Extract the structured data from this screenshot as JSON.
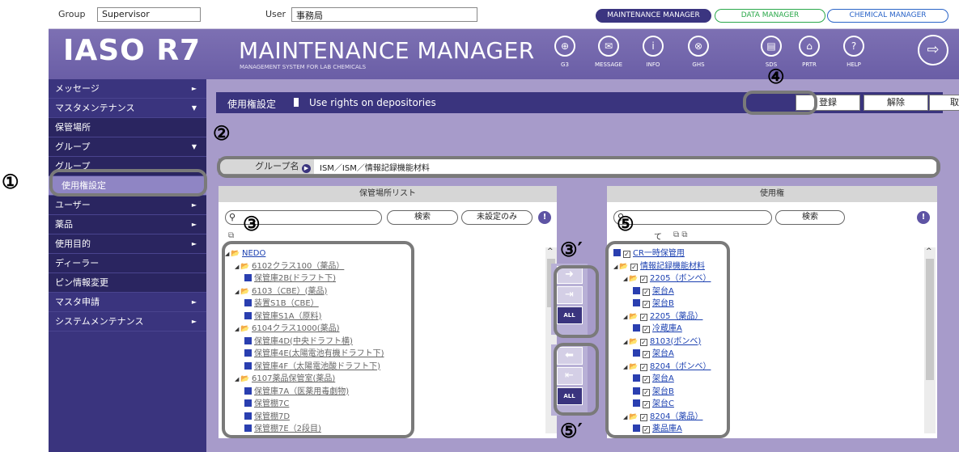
{
  "top": {
    "group_label": "Group",
    "group_value": "Supervisor",
    "user_label": "User",
    "user_value": "事務局",
    "tabs": [
      "MAINTENANCE MANAGER",
      "DATA MANAGER",
      "CHEMICAL MANAGER"
    ]
  },
  "header": {
    "logo": "IASO R7",
    "title": "MAINTENANCE MANAGER",
    "subtitle": "MANAGEMENT SYSTEM FOR LAB CHEMICALS",
    "icons": [
      {
        "name": "g3-icon",
        "label": "G3",
        "glyph": "⊕"
      },
      {
        "name": "message-icon",
        "label": "MESSAGE",
        "glyph": "✉"
      },
      {
        "name": "info-icon",
        "label": "INFO",
        "glyph": "i"
      },
      {
        "name": "ghs-icon",
        "label": "GHS",
        "glyph": "⊗"
      },
      {
        "name": "sds-icon",
        "label": "SDS",
        "glyph": "▤"
      },
      {
        "name": "prtr-icon",
        "label": "PRTR",
        "glyph": "⌂"
      },
      {
        "name": "help-icon",
        "label": "HELP",
        "glyph": "?"
      }
    ]
  },
  "sidebar": {
    "items": [
      {
        "label": "メッセージ",
        "arrow": "►",
        "kind": "top"
      },
      {
        "label": "マスタメンテナンス",
        "arrow": "▼",
        "kind": "top"
      },
      {
        "label": "保管場所",
        "arrow": "",
        "kind": "sub"
      },
      {
        "label": "グループ",
        "arrow": "▼",
        "kind": "sub"
      },
      {
        "label": "グループ",
        "arrow": "",
        "kind": "sub"
      },
      {
        "label": "使用権設定",
        "arrow": "",
        "kind": "active"
      },
      {
        "label": "ユーザー",
        "arrow": "►",
        "kind": "sub"
      },
      {
        "label": "薬品",
        "arrow": "►",
        "kind": "sub"
      },
      {
        "label": "使用目的",
        "arrow": "►",
        "kind": "sub"
      },
      {
        "label": "ディーラー",
        "arrow": "",
        "kind": "sub"
      },
      {
        "label": "ピン情報変更",
        "arrow": "",
        "kind": "sub"
      },
      {
        "label": "マスタ申請",
        "arrow": "►",
        "kind": "top"
      },
      {
        "label": "システムメンテナンス",
        "arrow": "►",
        "kind": "top"
      }
    ]
  },
  "main": {
    "title_jp": "使用権設定",
    "title_en": "Use rights on depositories",
    "buttons": {
      "register": "登録",
      "release": "解除",
      "cancel": "取消"
    },
    "group_name_label": "グループ名",
    "group_name_value": "ISM／ISM／情報記録機能材料"
  },
  "left_panel": {
    "header": "保管場所リスト",
    "search_btn": "検索",
    "unset_btn": "未設定のみ",
    "tree": [
      {
        "indent": 0,
        "type": "root",
        "label": "NEDO"
      },
      {
        "indent": 1,
        "type": "folder",
        "label": "6102クラス100（薬品）"
      },
      {
        "indent": 2,
        "type": "depo",
        "label": "保管庫2B(ドラフト下)"
      },
      {
        "indent": 1,
        "type": "folder",
        "label": "6103（CBE）(薬品)"
      },
      {
        "indent": 2,
        "type": "depo",
        "label": "装置S1B（CBE）"
      },
      {
        "indent": 2,
        "type": "depo",
        "label": "保管庫S1A（原料)"
      },
      {
        "indent": 1,
        "type": "folder",
        "label": "6104クラス1000(薬品)"
      },
      {
        "indent": 2,
        "type": "depo",
        "label": "保管庫4D(中央ドラフト横)"
      },
      {
        "indent": 2,
        "type": "depo",
        "label": "保管庫4E(太陽電池有機ドラフト下)"
      },
      {
        "indent": 2,
        "type": "depo",
        "label": "保管庫4F（太陽電池酸ドラフト下)"
      },
      {
        "indent": 1,
        "type": "folder",
        "label": "6107薬品保管室(薬品)"
      },
      {
        "indent": 2,
        "type": "depo",
        "label": "保管庫7A（医薬用毒劇物)"
      },
      {
        "indent": 2,
        "type": "depo",
        "label": "保管棚7C"
      },
      {
        "indent": 2,
        "type": "depo",
        "label": "保管棚7D"
      },
      {
        "indent": 2,
        "type": "depo",
        "label": "保管棚7E（2段目)"
      }
    ]
  },
  "right_panel": {
    "header": "使用権",
    "search_btn": "検索",
    "all_label": "て",
    "tree": [
      {
        "indent": 0,
        "type": "depo",
        "label": "CR一時保管用"
      },
      {
        "indent": 0,
        "type": "folder",
        "label": "情報記録機能材料"
      },
      {
        "indent": 1,
        "type": "folder",
        "label": "2205（ボンベ）"
      },
      {
        "indent": 2,
        "type": "depo",
        "label": "架台A"
      },
      {
        "indent": 2,
        "type": "depo",
        "label": "架台B"
      },
      {
        "indent": 1,
        "type": "folder",
        "label": "2205（薬品）"
      },
      {
        "indent": 2,
        "type": "depo",
        "label": "冷蔵庫A"
      },
      {
        "indent": 1,
        "type": "folder",
        "label": "8103(ボンベ)"
      },
      {
        "indent": 2,
        "type": "depo",
        "label": "架台A"
      },
      {
        "indent": 1,
        "type": "folder",
        "label": "8204（ボンベ）"
      },
      {
        "indent": 2,
        "type": "depo",
        "label": "架台A"
      },
      {
        "indent": 2,
        "type": "depo",
        "label": "架台B"
      },
      {
        "indent": 2,
        "type": "depo",
        "label": "架台C"
      },
      {
        "indent": 1,
        "type": "folder",
        "label": "8204（薬品）"
      },
      {
        "indent": 2,
        "type": "depo",
        "label": "薬品庫A"
      }
    ]
  },
  "transfer": {
    "all_add": "ALL",
    "all_remove": "ALL"
  },
  "annotations": [
    "①",
    "②",
    "③",
    "④",
    "③′",
    "⑤",
    "⑤′"
  ]
}
